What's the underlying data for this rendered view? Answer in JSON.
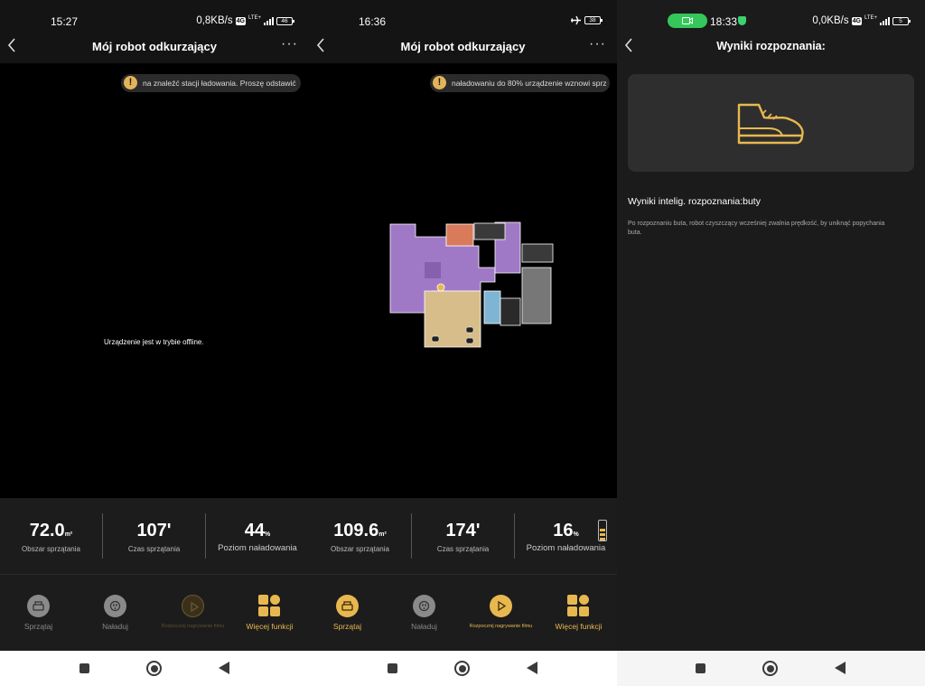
{
  "colors": {
    "accent": "#e8b850",
    "background": "#000000",
    "statusGreen": "#34c759"
  },
  "screen1": {
    "status": {
      "time": "15:27",
      "speed": "0,8KB/s",
      "net": "4G",
      "lte": "LTE+",
      "battery": "46"
    },
    "title": "Mój robot odkurzający",
    "more": "···",
    "notice": "na znaleźć stacji ładowania. Proszę odstawić",
    "offline_message": "Urządzenie jest w trybie offline.",
    "stats": [
      {
        "value": "72.0",
        "unit": "m²",
        "label": "Obszar sprzątania"
      },
      {
        "value": "107'",
        "unit": "",
        "label": "Czas sprzątania"
      },
      {
        "value": "44",
        "unit": "%",
        "label": "Poziom naładowania"
      }
    ],
    "actions": [
      {
        "label": "Sprzątaj",
        "icon": "vacuum-icon"
      },
      {
        "label": "Naładuj",
        "icon": "plug-icon"
      },
      {
        "label": "Rozpocznij nagrywanie filmu",
        "icon": "play-icon"
      },
      {
        "label": "Więcej funkcji",
        "icon": "grid-icon"
      }
    ]
  },
  "screen2": {
    "status": {
      "time": "16:36",
      "battery": "38"
    },
    "title": "Mój robot odkurzający",
    "more": "···",
    "notice": "naładowaniu do 80% urządzenie wznowi sprz",
    "stats": [
      {
        "value": "109.6",
        "unit": "m²",
        "label": "Obszar sprzątania"
      },
      {
        "value": "174'",
        "unit": "",
        "label": "Czas sprzątania"
      },
      {
        "value": "16",
        "unit": "%",
        "label": "Poziom naładowania"
      }
    ],
    "actions": [
      {
        "label": "Sprzątaj",
        "icon": "vacuum-icon"
      },
      {
        "label": "Naładuj",
        "icon": "plug-icon"
      },
      {
        "label": "Rozpocznij nagrywanie filmu",
        "icon": "play-icon"
      },
      {
        "label": "Więcej funkcji",
        "icon": "grid-icon"
      }
    ],
    "map_rooms": [
      "purple",
      "orange",
      "tan",
      "cyan",
      "gray"
    ]
  },
  "screen3": {
    "status": {
      "time": "18:33",
      "speed": "0,0KB/s",
      "net": "4G",
      "lte": "LTE+",
      "battery": "5"
    },
    "title": "Wyniki rozpoznania:",
    "result_title": "Wyniki intelig. rozpoznania:buty",
    "result_desc": "Po rozpoznaniu buta, robot czyszczący wcześniej zwalnia prędkość, by uniknąć popychania buta.",
    "icon": "shoe-icon"
  }
}
